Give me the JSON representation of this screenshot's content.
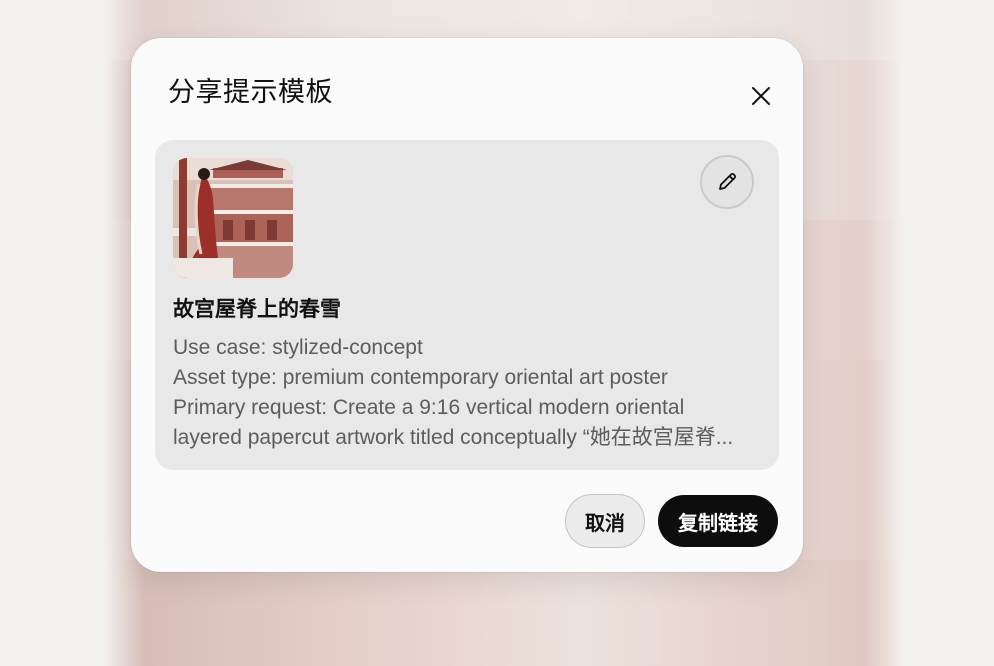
{
  "dialog": {
    "title": "分享提示模板",
    "close_icon": "close-icon"
  },
  "card": {
    "thumbnail_alt": "papercut-artwork-thumbnail",
    "edit_icon": "pencil-icon",
    "title": "故宫屋脊上的春雪",
    "prompt_lines": [
      "Use case: stylized-concept",
      "Asset type: premium contemporary oriental art poster",
      "Primary request: Create a 9:16 vertical modern oriental",
      "layered papercut artwork titled conceptually “她在故宫屋脊..."
    ]
  },
  "footer": {
    "cancel_label": "取消",
    "copy_label": "复制链接"
  },
  "colors": {
    "dialog_bg": "#fbfbfb",
    "card_bg": "#e8e8e8",
    "primary_button_bg": "#0d0d0d",
    "primary_button_text": "#ffffff",
    "secondary_button_bg": "#ececec"
  }
}
